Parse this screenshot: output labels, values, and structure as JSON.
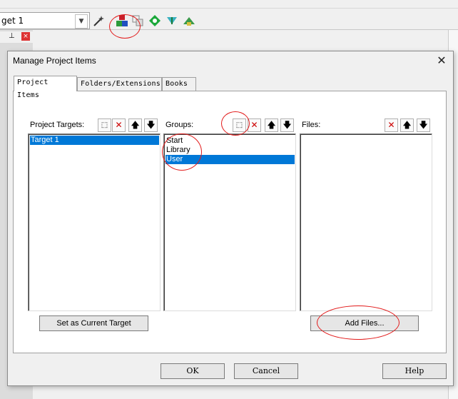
{
  "ide": {
    "target_combo": "get 1",
    "side_close": "×",
    "side_pin": "⊥"
  },
  "dialog": {
    "title": "Manage Project Items",
    "close_glyph": "✕",
    "tabs": [
      {
        "label": "Project Items"
      },
      {
        "label": "Folders/Extensions"
      },
      {
        "label": "Books"
      }
    ],
    "targets": {
      "label": "Project Targets:",
      "items": [
        "Target 1"
      ],
      "selected_index": 0
    },
    "groups": {
      "label": "Groups:",
      "items": [
        "Start",
        "Library",
        "User"
      ],
      "selected_index": 2
    },
    "files": {
      "label": "Files:",
      "items": []
    },
    "buttons": {
      "set_current": "Set as Current Target",
      "add_files": "Add Files...",
      "ok": "OK",
      "cancel": "Cancel",
      "help": "Help"
    },
    "glyphs": {
      "new": "⬚",
      "delete": "✕",
      "up": "🡅",
      "down": "🡇"
    }
  },
  "colors": {
    "selection": "#0078d7",
    "annotation": "#e21a1a"
  }
}
